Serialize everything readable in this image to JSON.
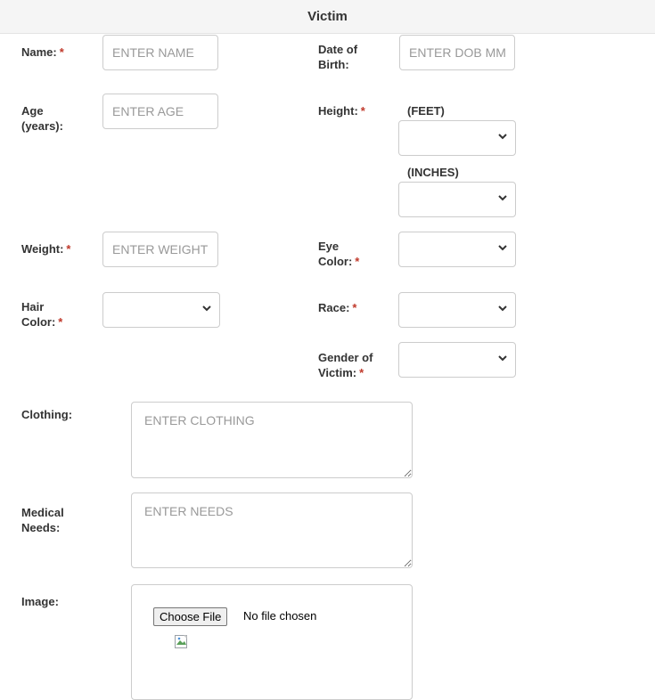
{
  "header": {
    "title": "Victim"
  },
  "required_marker": "*",
  "fields": {
    "name": {
      "label": "Name:",
      "placeholder": "ENTER NAME"
    },
    "dob": {
      "label_line1": "Date of",
      "label_line2": "Birth:",
      "placeholder": "ENTER DOB MM/DD/YYYY"
    },
    "age": {
      "label_line1": "Age",
      "label_line2": "(years):",
      "placeholder": "ENTER AGE"
    },
    "height": {
      "label": "Height:",
      "feet_label": "(FEET)",
      "inches_label": "(INCHES)",
      "feet_value": "",
      "inches_value": ""
    },
    "weight": {
      "label": "Weight:",
      "placeholder": "ENTER WEIGHT"
    },
    "eye_color": {
      "label_line1": "Eye",
      "label_line2": "Color:",
      "value": ""
    },
    "hair_color": {
      "label_line1": "Hair",
      "label_line2": "Color:",
      "value": ""
    },
    "race": {
      "label": "Race:",
      "value": ""
    },
    "gender": {
      "label_line1": "Gender of",
      "label_line2": "Victim:",
      "value": ""
    },
    "clothing": {
      "label": "Clothing:",
      "placeholder": "ENTER CLOTHING"
    },
    "medical_needs": {
      "label_line1": "Medical",
      "label_line2": "Needs:",
      "placeholder": "ENTER NEEDS"
    },
    "image": {
      "label": "Image:",
      "button_label": "Choose File",
      "status": "No file chosen"
    }
  },
  "icons": {
    "select_arrow": "chevron-down-icon",
    "image_placeholder": "broken-image-icon"
  },
  "colors": {
    "required": "#c0392b",
    "border": "#cccccc",
    "header_bg": "#f5f5f5",
    "placeholder": "#999999"
  }
}
